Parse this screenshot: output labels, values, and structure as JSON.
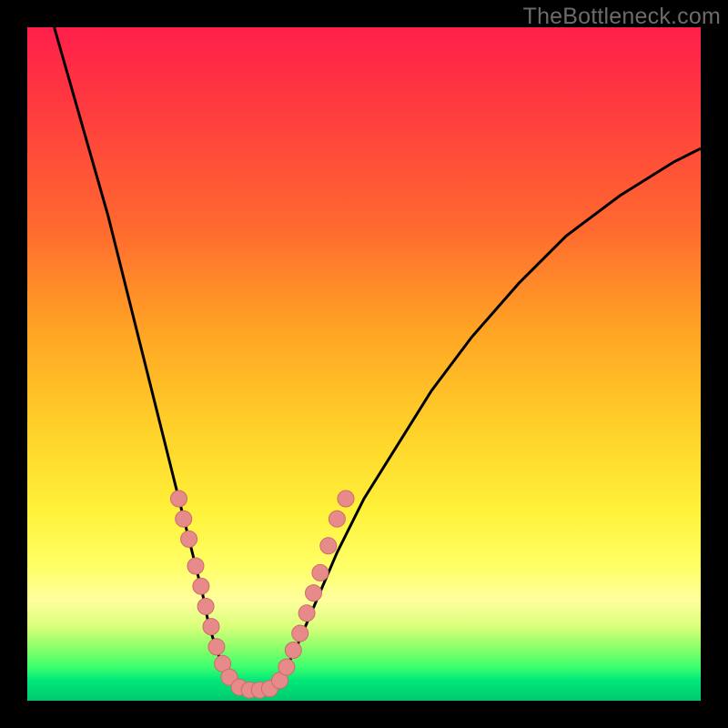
{
  "watermark": "TheBottleneck.com",
  "chart_data": {
    "type": "line",
    "title": "",
    "xlabel": "",
    "ylabel": "",
    "xlim": [
      0,
      100
    ],
    "ylim": [
      0,
      100
    ],
    "grid": false,
    "legend": false,
    "series": [
      {
        "name": "curve-left",
        "x": [
          4,
          8,
          12,
          15,
          18,
          20,
          22,
          24,
          26,
          27,
          28,
          29,
          30,
          31
        ],
        "y": [
          100,
          86,
          72,
          60,
          48,
          40,
          32,
          24,
          16,
          11,
          8,
          5,
          3,
          2
        ]
      },
      {
        "name": "valley-floor",
        "x": [
          31,
          33,
          35,
          37
        ],
        "y": [
          2,
          1.5,
          1.5,
          2
        ]
      },
      {
        "name": "curve-right",
        "x": [
          37,
          38,
          40,
          43,
          46,
          50,
          55,
          60,
          66,
          73,
          80,
          88,
          96,
          100
        ],
        "y": [
          2,
          4,
          8,
          15,
          22,
          30,
          38,
          46,
          54,
          62,
          69,
          75,
          80,
          82
        ]
      }
    ],
    "markers": [
      {
        "name": "left-cluster",
        "x": 22.5,
        "y": 30
      },
      {
        "name": "left-cluster",
        "x": 23.2,
        "y": 27
      },
      {
        "name": "left-cluster",
        "x": 24.0,
        "y": 24
      },
      {
        "name": "left-cluster",
        "x": 25.0,
        "y": 20
      },
      {
        "name": "left-cluster",
        "x": 25.8,
        "y": 17
      },
      {
        "name": "left-cluster",
        "x": 26.5,
        "y": 14
      },
      {
        "name": "left-cluster",
        "x": 27.3,
        "y": 11
      },
      {
        "name": "left-cluster",
        "x": 28.1,
        "y": 8
      },
      {
        "name": "left-cluster",
        "x": 29.0,
        "y": 5.5
      },
      {
        "name": "left-cluster",
        "x": 30.0,
        "y": 3.5
      },
      {
        "name": "floor",
        "x": 31.5,
        "y": 2
      },
      {
        "name": "floor",
        "x": 33.0,
        "y": 1.6
      },
      {
        "name": "floor",
        "x": 34.5,
        "y": 1.6
      },
      {
        "name": "floor",
        "x": 36.0,
        "y": 1.8
      },
      {
        "name": "right-cluster",
        "x": 37.5,
        "y": 3
      },
      {
        "name": "right-cluster",
        "x": 38.5,
        "y": 5
      },
      {
        "name": "right-cluster",
        "x": 39.5,
        "y": 7.5
      },
      {
        "name": "right-cluster",
        "x": 40.5,
        "y": 10
      },
      {
        "name": "right-cluster",
        "x": 41.5,
        "y": 13
      },
      {
        "name": "right-cluster",
        "x": 42.5,
        "y": 16
      },
      {
        "name": "right-cluster",
        "x": 43.5,
        "y": 19
      },
      {
        "name": "right-cluster",
        "x": 44.7,
        "y": 23
      },
      {
        "name": "right-cluster",
        "x": 46.0,
        "y": 27
      },
      {
        "name": "right-cluster",
        "x": 47.3,
        "y": 30
      }
    ],
    "colors": {
      "curve": "#000000",
      "marker_fill": "#e68a8a",
      "marker_stroke": "#d06a6a"
    }
  }
}
